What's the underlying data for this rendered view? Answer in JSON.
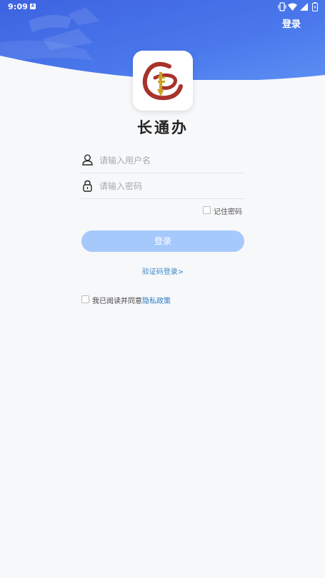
{
  "status_bar": {
    "time": "9:09",
    "notification_icon": "a-notification-icon",
    "icons": [
      "vibrate-icon",
      "wifi-icon",
      "signal-icon",
      "battery-icon"
    ]
  },
  "header": {
    "login_label": "登录"
  },
  "app": {
    "name": "长通办",
    "logo_icon": "app-logo-icon"
  },
  "form": {
    "username_placeholder": "请输入用户名",
    "username_value": "",
    "password_placeholder": "请输入密码",
    "password_value": "",
    "remember_label": "记住密码",
    "remember_checked": false,
    "login_button": "登录",
    "sms_login_link": "验证码登录>"
  },
  "agreement": {
    "text": "我已阅读并同意",
    "policy_link": "隐私政策",
    "checked": false
  },
  "colors": {
    "header_blue": "#3f6fe6",
    "button_disabled": "#a6c9fc",
    "link": "#3d88cc",
    "background": "#f7f8fa"
  }
}
